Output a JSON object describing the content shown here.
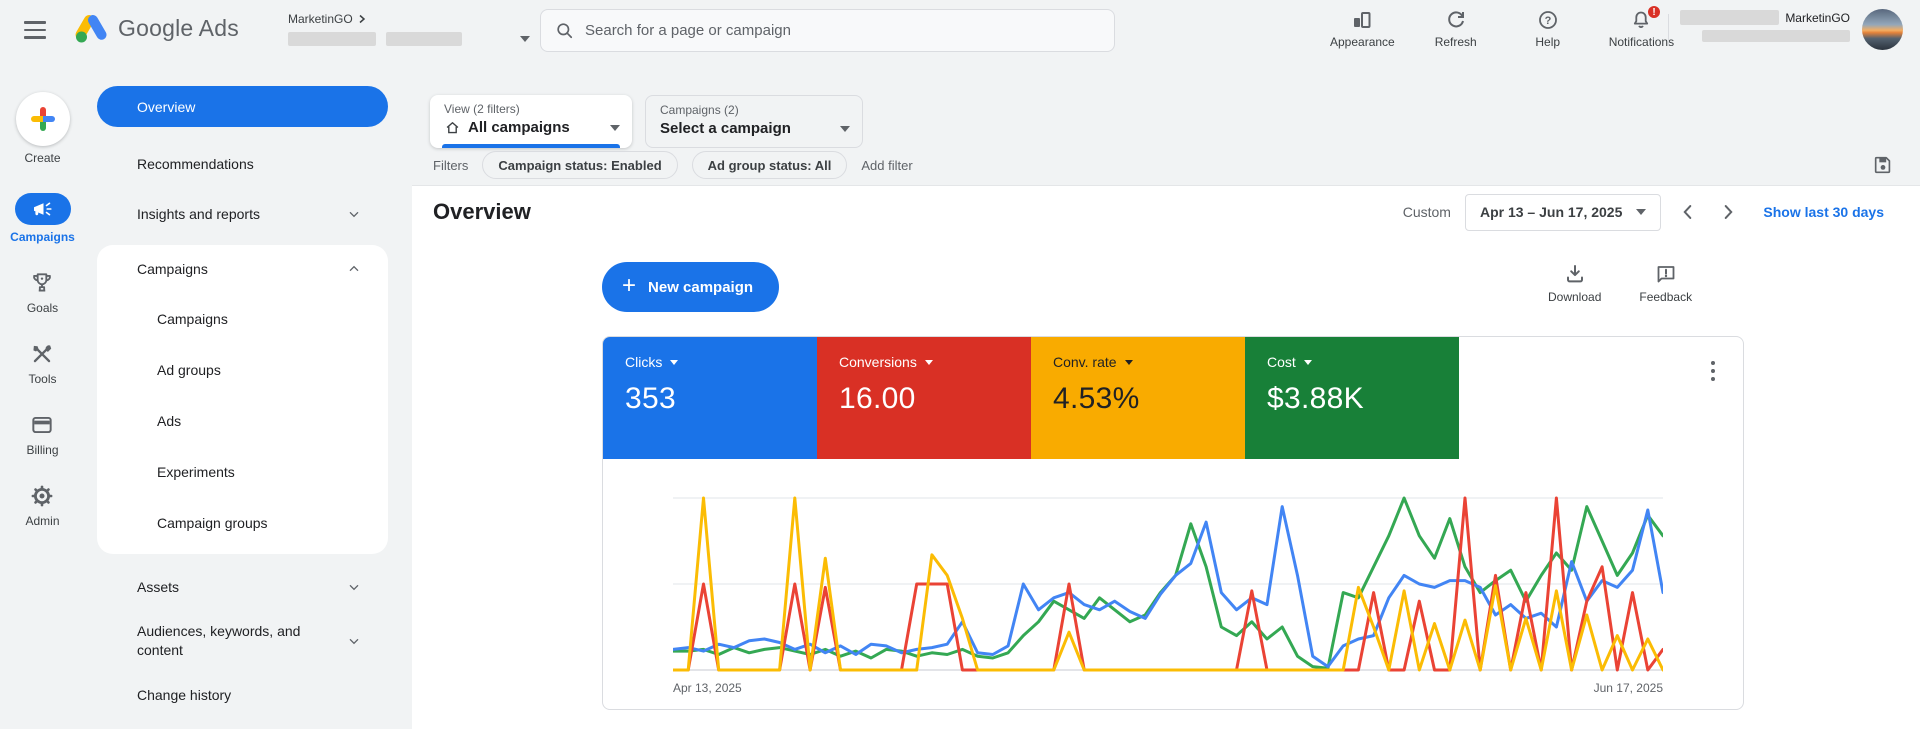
{
  "topbar": {
    "product_name": "Google Ads",
    "account_name": "MarketinGO",
    "search_placeholder": "Search for a page or campaign",
    "actions": [
      {
        "label": "Appearance",
        "icon": "bar-chart-icon"
      },
      {
        "label": "Refresh",
        "icon": "refresh-icon"
      },
      {
        "label": "Help",
        "icon": "help-icon"
      },
      {
        "label": "Notifications",
        "icon": "bell-icon"
      }
    ],
    "notification_badge": "!",
    "user_org": "MarketinGO"
  },
  "rail": {
    "items": [
      {
        "label": "Create",
        "icon": "plus-icon"
      },
      {
        "label": "Campaigns",
        "icon": "megaphone-icon",
        "active": true
      },
      {
        "label": "Goals",
        "icon": "trophy-icon"
      },
      {
        "label": "Tools",
        "icon": "tools-icon"
      },
      {
        "label": "Billing",
        "icon": "credit-card-icon"
      },
      {
        "label": "Admin",
        "icon": "gear-icon"
      }
    ]
  },
  "nav": {
    "items": [
      {
        "label": "Overview",
        "selected": true
      },
      {
        "label": "Recommendations"
      },
      {
        "label": "Insights and reports",
        "expandable": true,
        "expanded": false
      },
      {
        "label": "Campaigns",
        "expandable": true,
        "expanded": true,
        "children": [
          "Campaigns",
          "Ad groups",
          "Ads",
          "Experiments",
          "Campaign groups"
        ]
      },
      {
        "label": "Assets",
        "expandable": true,
        "expanded": false
      },
      {
        "label": "Audiences, keywords, and content",
        "expandable": true,
        "expanded": false
      },
      {
        "label": "Change history"
      }
    ]
  },
  "filter_bar": {
    "view_label": "View (2 filters)",
    "view_value": "All campaigns",
    "campaign_label": "Campaigns (2)",
    "campaign_value": "Select a campaign",
    "filters_label": "Filters",
    "chips": [
      "Campaign status: Enabled",
      "Ad group status: All"
    ],
    "add_filter": "Add filter"
  },
  "page": {
    "title": "Overview",
    "date_mode": "Custom",
    "date_range": "Apr 13 – Jun 17, 2025",
    "show_last": "Show last 30 days",
    "new_campaign_label": "New campaign",
    "download_label": "Download",
    "feedback_label": "Feedback"
  },
  "scorecards": [
    {
      "label": "Clicks",
      "value": "353",
      "color": "#1a73e8",
      "text_color": "#ffffff"
    },
    {
      "label": "Conversions",
      "value": "16.00",
      "color": "#d93025",
      "text_color": "#ffffff"
    },
    {
      "label": "Conv. rate",
      "value": "4.53%",
      "color": "#f9ab00",
      "text_color": "#202124"
    },
    {
      "label": "Cost",
      "value": "$3.88K",
      "color": "#188038",
      "text_color": "#ffffff"
    }
  ],
  "chart_data": {
    "type": "line",
    "title": "Overview performance trend (daily)",
    "x_axis": {
      "start_label": "Apr 13, 2025",
      "end_label": "Jun 17, 2025",
      "points": 66,
      "unit": "day"
    },
    "y_axis": {
      "min": 0,
      "max": 100,
      "note": "No numeric ticks shown on screen; values are estimated % of chart height"
    },
    "gridlines": {
      "horizontal": 3
    },
    "legend": "none — series colors match the scorecards above",
    "series": [
      {
        "name": "Clicks",
        "color": "#4285f4",
        "z": 2,
        "values": [
          12,
          13,
          11,
          15,
          13,
          17,
          18,
          16,
          12,
          15,
          10,
          14,
          9,
          15,
          14,
          10,
          12,
          13,
          15,
          28,
          10,
          9,
          14,
          50,
          35,
          42,
          45,
          38,
          35,
          40,
          34,
          30,
          44,
          55,
          62,
          86,
          45,
          35,
          42,
          38,
          95,
          55,
          8,
          2,
          14,
          18,
          20,
          42,
          55,
          50,
          48,
          52,
          52,
          48,
          32,
          38,
          30,
          33,
          25,
          63,
          40,
          52,
          48,
          58,
          93,
          45
        ]
      },
      {
        "name": "Conversions",
        "color": "#ea4335",
        "z": 3,
        "values": [
          0,
          0,
          50,
          0,
          0,
          0,
          0,
          0,
          50,
          0,
          48,
          0,
          0,
          0,
          0,
          0,
          50,
          50,
          50,
          0,
          0,
          0,
          0,
          0,
          0,
          0,
          50,
          0,
          0,
          0,
          0,
          0,
          0,
          0,
          0,
          0,
          0,
          0,
          46,
          0,
          0,
          0,
          0,
          0,
          0,
          0,
          45,
          0,
          0,
          40,
          0,
          0,
          100,
          0,
          55,
          0,
          45,
          0,
          100,
          0,
          40,
          60,
          0,
          45,
          0,
          12
        ]
      },
      {
        "name": "Conv. rate",
        "color": "#fbbc04",
        "z": 4,
        "values": [
          0,
          0,
          100,
          0,
          0,
          0,
          0,
          0,
          100,
          0,
          65,
          0,
          0,
          0,
          0,
          0,
          0,
          67,
          55,
          30,
          0,
          0,
          0,
          0,
          0,
          0,
          22,
          0,
          0,
          0,
          0,
          0,
          0,
          0,
          0,
          0,
          0,
          0,
          0,
          0,
          0,
          0,
          0,
          0,
          0,
          48,
          25,
          0,
          46,
          0,
          27,
          0,
          29,
          0,
          49,
          0,
          30,
          0,
          46,
          0,
          32,
          0,
          20,
          0,
          18,
          0
        ]
      },
      {
        "name": "Cost",
        "color": "#34a853",
        "z": 1,
        "values": [
          11,
          11,
          12,
          9,
          13,
          10,
          12,
          13,
          11,
          9,
          12,
          8,
          11,
          7,
          12,
          11,
          8,
          10,
          9,
          12,
          8,
          7,
          10,
          20,
          28,
          40,
          35,
          30,
          42,
          35,
          28,
          32,
          45,
          55,
          85,
          60,
          25,
          20,
          28,
          18,
          25,
          8,
          2,
          1,
          45,
          42,
          60,
          78,
          100,
          78,
          65,
          88,
          60,
          45,
          52,
          58,
          40,
          55,
          68,
          58,
          95,
          75,
          55,
          68,
          90,
          78
        ]
      }
    ]
  },
  "colors": {
    "accent": "#1a73e8",
    "background": "#f1f3f4",
    "border": "#dadce0"
  }
}
